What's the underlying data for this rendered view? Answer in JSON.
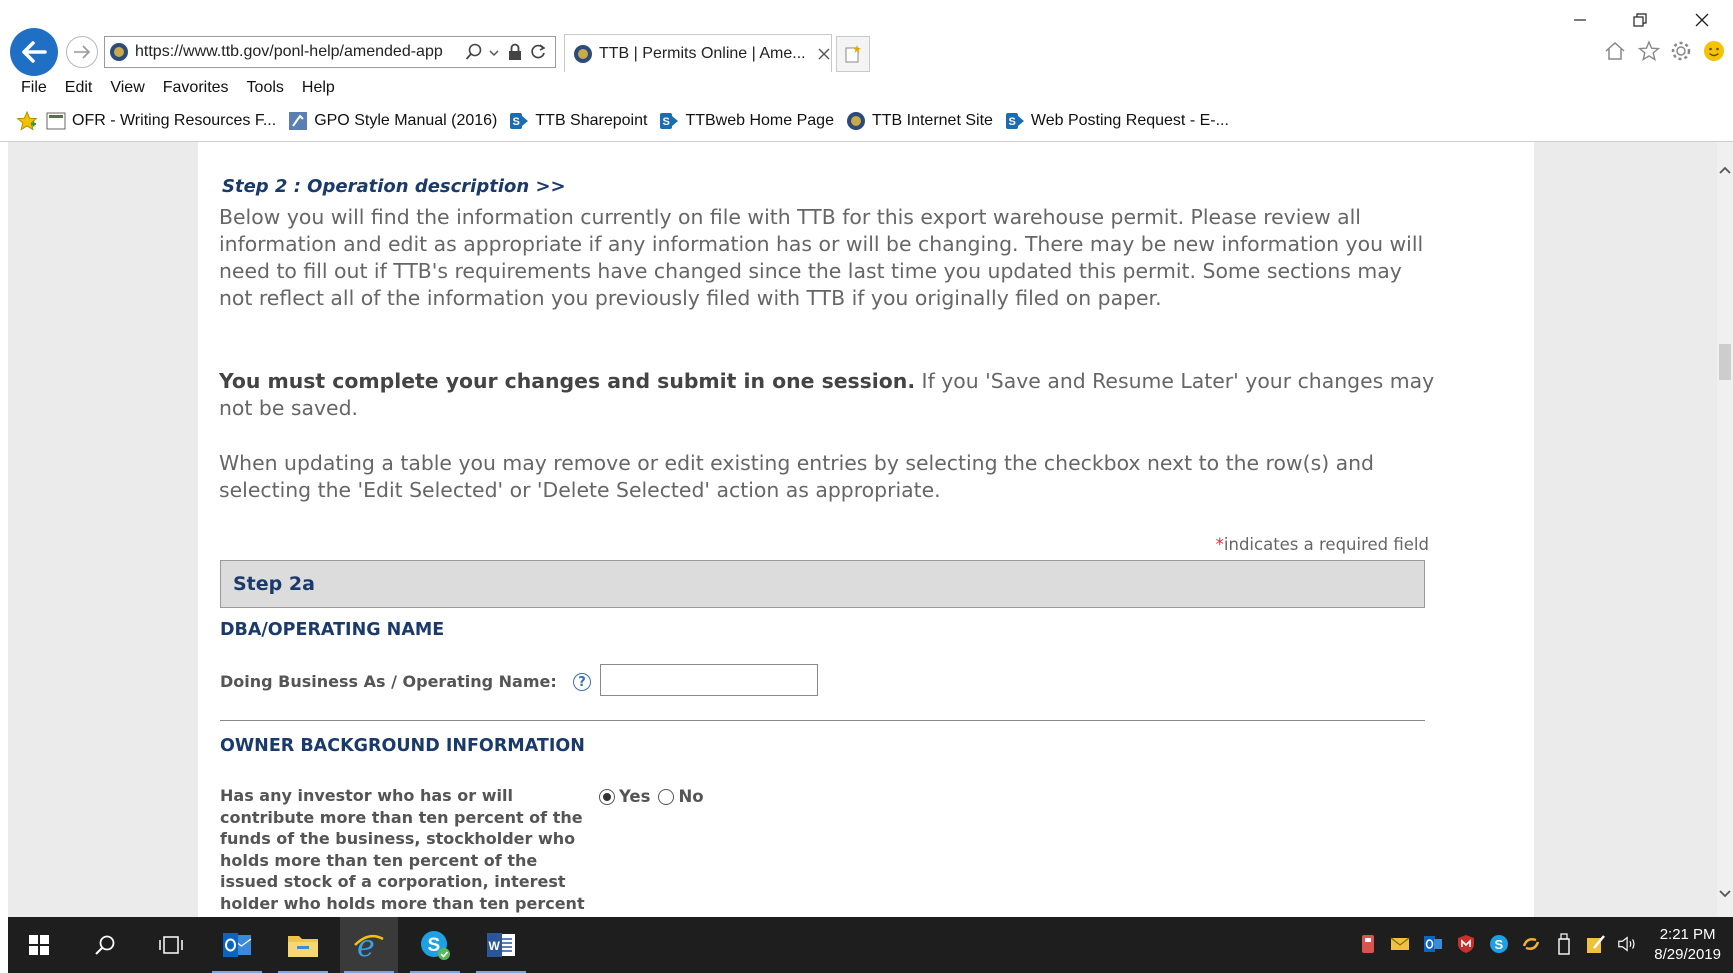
{
  "browser": {
    "url": "https://www.ttb.gov/ponl-help/amended-app",
    "tab_title": "TTB | Permits Online | Ame...",
    "menu": [
      "File",
      "Edit",
      "View",
      "Favorites",
      "Tools",
      "Help"
    ],
    "favorites": [
      {
        "label": "OFR - Writing Resources F...",
        "icon": "document-icon"
      },
      {
        "label": "GPO Style Manual (2016)",
        "icon": "gpo-icon"
      },
      {
        "label": "TTB Sharepoint",
        "icon": "sharepoint-icon"
      },
      {
        "label": "TTBweb Home Page",
        "icon": "sharepoint-icon"
      },
      {
        "label": "TTB Internet Site",
        "icon": "ttb-seal-icon"
      },
      {
        "label": "Web Posting Request - E-...",
        "icon": "sharepoint-icon"
      }
    ]
  },
  "page": {
    "step_heading": "Step 2 : Operation description >>",
    "intro": "Below you will find the information currently on file with TTB for this export warehouse permit. Please review all information and edit as appropriate if any information has or will be changing. There may be new information you will need to fill out if TTB's requirements have changed since the last time you updated this permit. Some sections may not reflect all of the information you previously filed with TTB if you originally filed on paper.",
    "session_bold": "You must complete your changes and submit in one session.",
    "session_rest": " If you 'Save and Resume Later' your changes may not be saved.",
    "table_note": "When updating a table you may remove or edit existing entries by selecting the checkbox next to the row(s) and selecting the 'Edit Selected' or 'Delete Selected' action as appropriate.",
    "required_star": "*",
    "required_note": "indicates a required field",
    "step_box": "Step 2a",
    "dba_title": "DBA/OPERATING NAME",
    "dba_label": "Doing Business As / Operating Name:",
    "dba_value": "",
    "help_glyph": "?",
    "owner_title": "OWNER BACKGROUND INFORMATION",
    "owner_question": "Has any investor who has or will contribute more than ten percent of the funds of the business, stockholder who holds more than ten percent of the issued stock of a corporation, interest holder who holds more than ten percent interest",
    "yes_label": "Yes",
    "no_label": "No",
    "selected": "Yes"
  },
  "taskbar": {
    "apps": [
      "start-icon",
      "search-icon",
      "task-view-icon",
      "outlook-icon",
      "file-explorer-icon",
      "internet-explorer-icon",
      "skype-icon",
      "word-icon"
    ],
    "time": "2:21 PM",
    "date": "8/29/2019"
  },
  "colors": {
    "heading_blue": "#1a3a6b",
    "body_gray": "#666666",
    "back_button": "#1f6fc5",
    "taskbar": "#1e1e1e"
  }
}
